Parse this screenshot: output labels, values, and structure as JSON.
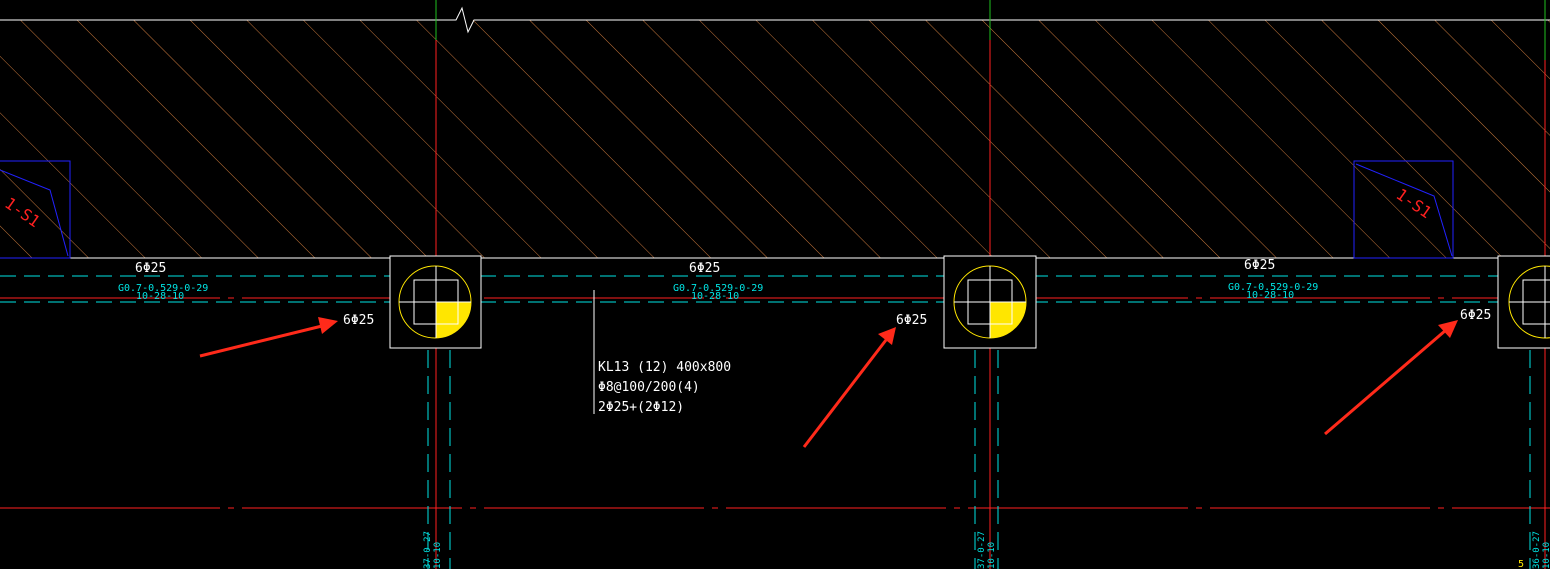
{
  "colors": {
    "background": "#000000",
    "hatch": "#c8783c",
    "axis_red": "#ff2020",
    "axis_green": "#20c020",
    "cyan": "#00e5e5",
    "white": "#ffffff",
    "blue": "#2222ff",
    "yellow": "#ffe600",
    "arrow": "#ff2a1a"
  },
  "spans": [
    {
      "top_rebar": "6Φ25",
      "code_line1": "G0.7-0.529-0-29",
      "code_line2": "10-28-10"
    },
    {
      "top_rebar": "6Φ25",
      "code_line1": "G0.7-0.529-0-29",
      "code_line2": "10-28-10"
    },
    {
      "top_rebar": "6Φ25",
      "code_line1": "G0.7-0.529-0-29",
      "code_line2": "10-28-10"
    }
  ],
  "support_rebar": [
    "6Φ25",
    "6Φ25",
    "6Φ25"
  ],
  "beam_note": {
    "line1": "KL13 (12) 400x800",
    "line2": "Φ8@100/200(4)",
    "line3": "2Φ25+(2Φ12)"
  },
  "slab_marks": [
    "1-S1",
    "1-S1"
  ],
  "column_tags": [
    "37-0-27",
    "10-10",
    "37-0-27",
    "10-10",
    "36-0-27",
    "10-10"
  ],
  "edge_mark": "5",
  "arrows": [
    "arrow-to-support-1",
    "arrow-to-support-2",
    "arrow-to-support-3"
  ]
}
